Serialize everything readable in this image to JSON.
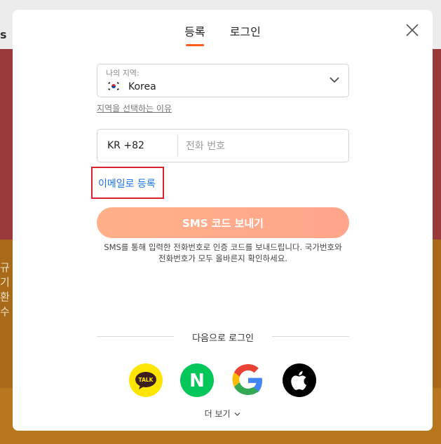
{
  "background": {
    "left_text": [
      "규",
      "기",
      "환",
      "수"
    ],
    "partial_letter": "s"
  },
  "tabs": [
    {
      "label": "등록",
      "active": true
    },
    {
      "label": "로그인",
      "active": false
    }
  ],
  "region": {
    "label": "나의 지역:",
    "value": "Korea",
    "why_link": "지역을 선택하는 이유"
  },
  "phone": {
    "country_code": "KR +82",
    "placeholder": "전화 번호"
  },
  "email_register_link": "이메일로 등록",
  "sms_button": "SMS 코드 보내기",
  "sms_note": "SMS를 통해 입력한 전화번호로 인증 코드를 보내드립니다. 국가번호와 전화번호가 모두 올바른지 확인하세요.",
  "social": {
    "divider_label": "다음으로 로그인",
    "kakao_label": "TALK",
    "naver_label": "N",
    "more_label": "더 보기"
  },
  "colors": {
    "accent": "#ff5a1f",
    "highlight_border": "#d9232e",
    "link_blue": "#1a73e8"
  }
}
